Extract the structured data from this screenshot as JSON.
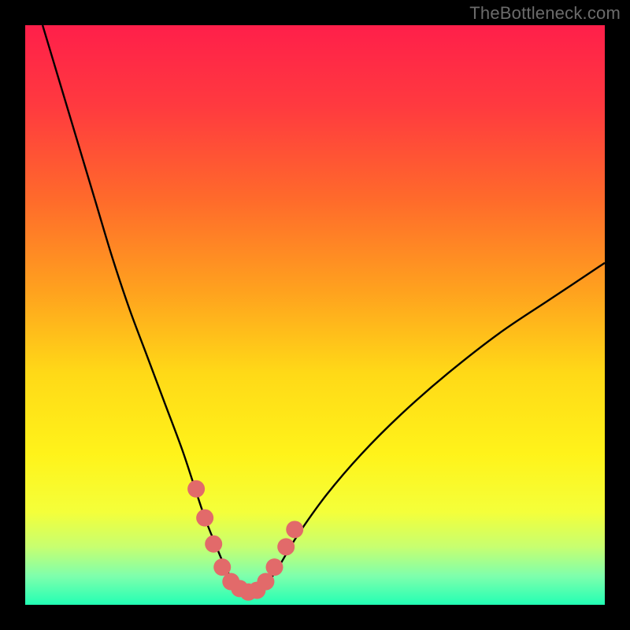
{
  "watermark": "TheBottleneck.com",
  "colors": {
    "frame": "#000000",
    "gradient_stops": [
      {
        "offset": 0.0,
        "color": "#ff1f4a"
      },
      {
        "offset": 0.14,
        "color": "#ff3a3f"
      },
      {
        "offset": 0.3,
        "color": "#ff6a2b"
      },
      {
        "offset": 0.46,
        "color": "#ffa21e"
      },
      {
        "offset": 0.6,
        "color": "#ffd917"
      },
      {
        "offset": 0.74,
        "color": "#fff31a"
      },
      {
        "offset": 0.84,
        "color": "#f4ff3a"
      },
      {
        "offset": 0.9,
        "color": "#c7ff70"
      },
      {
        "offset": 0.95,
        "color": "#7fffac"
      },
      {
        "offset": 1.0,
        "color": "#22ffb4"
      }
    ],
    "curve_stroke": "#000000",
    "marker_fill": "#e26a6a",
    "marker_stroke": "#c94f4f"
  },
  "chart_data": {
    "type": "line",
    "title": "",
    "xlabel": "",
    "ylabel": "",
    "xlim": [
      0,
      100
    ],
    "ylim": [
      0,
      100
    ],
    "grid": false,
    "legend": false,
    "series": [
      {
        "name": "bottleneck-curve",
        "x": [
          3,
          6,
          9,
          12,
          15,
          18,
          21,
          24,
          27,
          29,
          31,
          33,
          34.5,
          36,
          37.5,
          39,
          40.5,
          42,
          44,
          47,
          52,
          58,
          65,
          73,
          82,
          91,
          100
        ],
        "y": [
          100,
          90,
          80,
          70,
          60,
          51,
          43,
          35,
          27,
          21,
          15,
          10,
          6.5,
          4,
          2.5,
          2,
          2.5,
          4,
          7,
          12,
          19,
          26,
          33,
          40,
          47,
          53,
          59
        ]
      }
    ],
    "markers": [
      {
        "x": 29.5,
        "y": 20.0
      },
      {
        "x": 31.0,
        "y": 15.0
      },
      {
        "x": 32.5,
        "y": 10.5
      },
      {
        "x": 34.0,
        "y": 6.5
      },
      {
        "x": 35.5,
        "y": 4.0
      },
      {
        "x": 37.0,
        "y": 2.8
      },
      {
        "x": 38.5,
        "y": 2.2
      },
      {
        "x": 40.0,
        "y": 2.5
      },
      {
        "x": 41.5,
        "y": 4.0
      },
      {
        "x": 43.0,
        "y": 6.5
      },
      {
        "x": 45.0,
        "y": 10.0
      },
      {
        "x": 46.5,
        "y": 13.0
      }
    ]
  }
}
